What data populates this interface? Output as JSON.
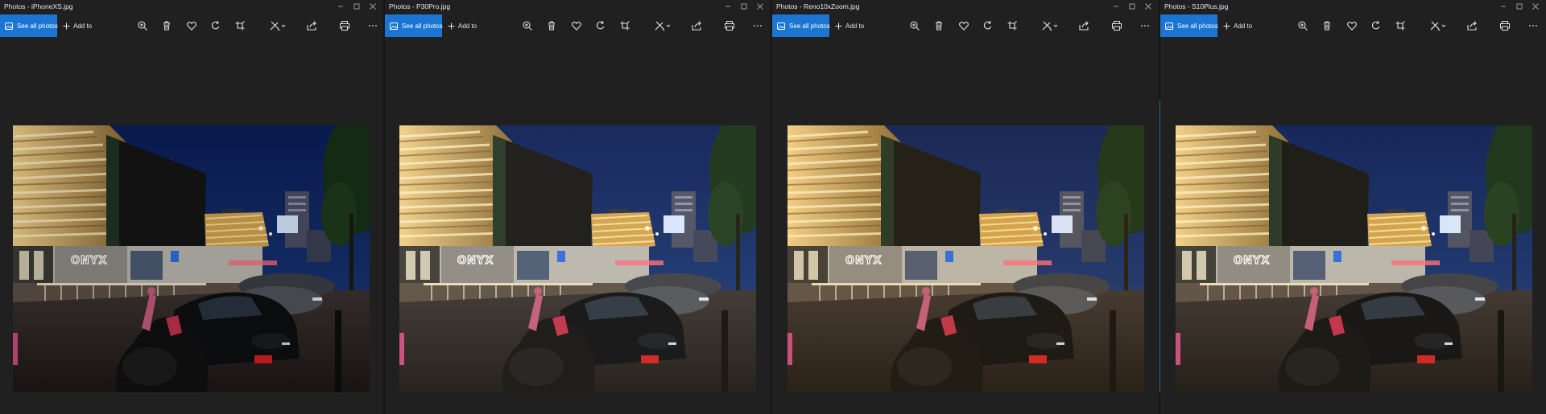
{
  "windows": [
    {
      "title": "Photos - iPhoneXS.jpg",
      "tone": "#c99a4a"
    },
    {
      "title": "Photos - P30Pro.jpg",
      "tone": "#e0b95c"
    },
    {
      "title": "Photos - Reno10xZoom.jpg",
      "tone": "#d9a43f"
    },
    {
      "title": "Photos - S10Plus.jpg",
      "tone": "#e2ad45"
    }
  ],
  "toolbar": {
    "see_all_label": "See all photos",
    "add_to_label": "Add to",
    "icons": [
      "zoom-in-icon",
      "delete-icon",
      "heart-icon",
      "rotate-icon",
      "crop-icon",
      "edit-create-icon",
      "share-icon",
      "print-icon",
      "more-icon"
    ]
  },
  "photo": {
    "sign_text": "ONYX",
    "plate_text": "ONYX",
    "accent": "#1a76d2"
  }
}
